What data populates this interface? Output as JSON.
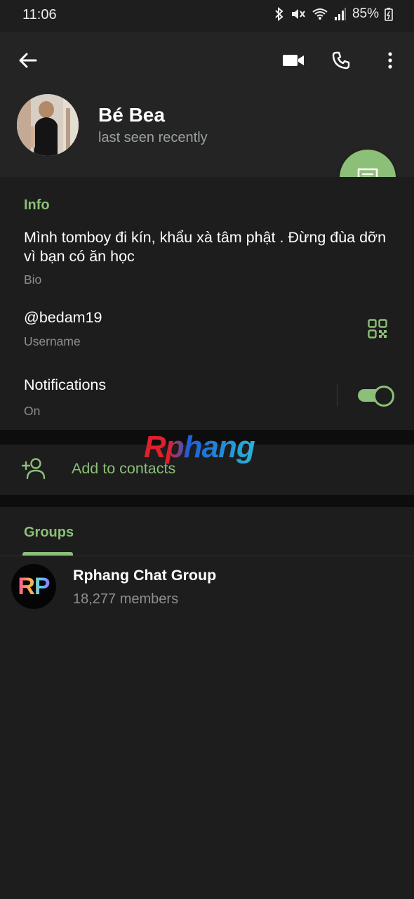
{
  "status_bar": {
    "time": "11:06",
    "battery": "85%",
    "icons": [
      "bluetooth-icon",
      "mute-icon",
      "wifi-icon",
      "signal-icon",
      "battery-icon"
    ]
  },
  "header": {
    "icons": [
      "back-arrow-icon",
      "video-call-icon",
      "phone-icon",
      "more-vert-icon"
    ],
    "name": "Bé Bea",
    "status": "last seen recently"
  },
  "info": {
    "title": "Info",
    "bio": "Mình tomboy đi kín, khẩu xà tâm phật . Đừng đùa dỡn vì bạn có ăn học",
    "bio_label": "Bio",
    "username": "@bedam19",
    "username_label": "Username",
    "notifications": "Notifications",
    "notifications_state": "On",
    "notifications_on": true
  },
  "actions": {
    "add_contact": "Add to contacts"
  },
  "groups": {
    "tab": "Groups",
    "items": [
      {
        "name": "Rphang Chat Group",
        "members": "18,277 members",
        "avatar_text": "RP"
      }
    ]
  },
  "watermark": "Rphang",
  "colors": {
    "accent": "#8cbf77",
    "background": "#1d1d1d",
    "header": "#242424",
    "secondary_text": "#8d9090"
  }
}
